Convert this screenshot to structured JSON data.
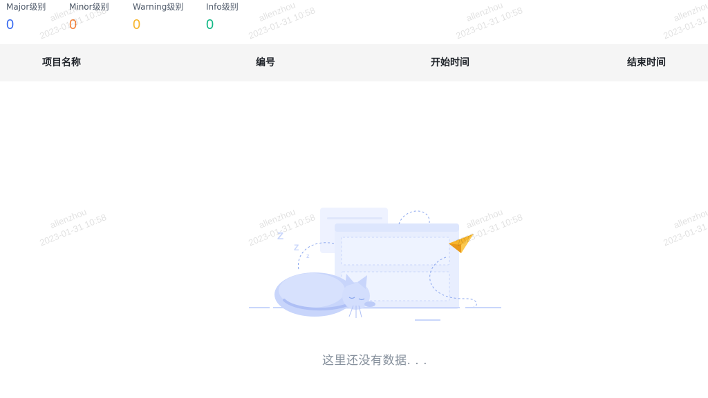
{
  "stats": [
    {
      "label": "Major级别",
      "value": "0",
      "color": "#3c6df0"
    },
    {
      "label": "Minor级别",
      "value": "0",
      "color": "#f5853f"
    },
    {
      "label": "Warning级别",
      "value": "0",
      "color": "#f7b52c"
    },
    {
      "label": "Info级别",
      "value": "0",
      "color": "#12b886"
    }
  ],
  "table": {
    "columns": [
      "项目名称",
      "编号",
      "开始时间",
      "结束时间"
    ]
  },
  "empty": {
    "message": "这里还没有数据. . ."
  },
  "watermark": {
    "user": "allenzhou",
    "datetime": "2023-01-31 10:58"
  }
}
